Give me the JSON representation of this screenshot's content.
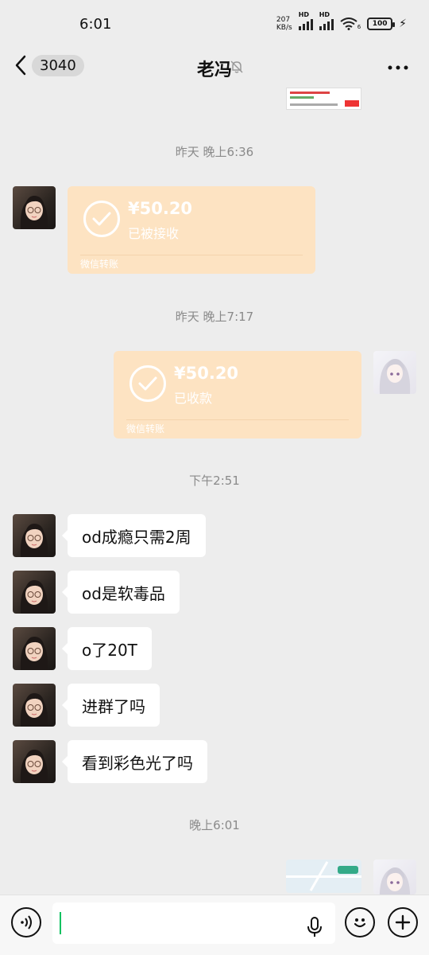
{
  "status_bar": {
    "time": "6:01",
    "net_speed_value": "207",
    "net_speed_unit": "KB/s",
    "signal1_label": "HD",
    "signal2_label": "HD",
    "wifi_label": "6",
    "battery_level": "100"
  },
  "header": {
    "unread_count": "3040",
    "title": "老冯"
  },
  "messages": {
    "time1": "昨天 晚上6:36",
    "transfer1": {
      "amount": "¥50.20",
      "status": "已被接收",
      "footer": "微信转账"
    },
    "time2": "昨天 晚上7:17",
    "transfer2": {
      "amount": "¥50.20",
      "status": "已收款",
      "footer": "微信转账"
    },
    "time3": "下午2:51",
    "texts": [
      "od成瘾只需2周",
      "od是软毒品",
      "o了20T",
      "进群了吗",
      "看到彩色光了吗"
    ],
    "time4": "晚上6:01"
  },
  "colors": {
    "background": "#ededed",
    "transfer_bubble": "#fde3c2",
    "wechat_green": "#07c160"
  }
}
